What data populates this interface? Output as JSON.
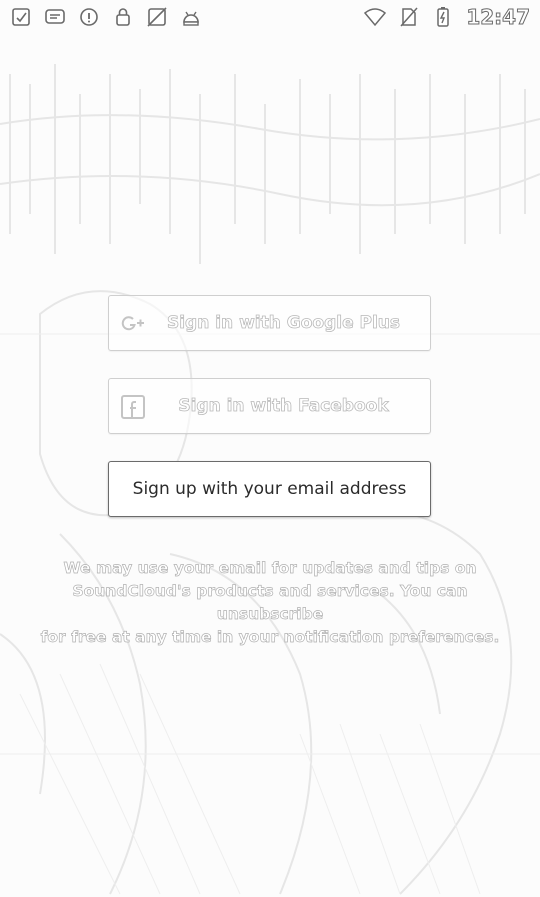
{
  "status_bar": {
    "icons": [
      "tasks-icon",
      "message-icon",
      "info-icon",
      "lock-icon",
      "no-image-icon",
      "android-icon"
    ],
    "right_icons": [
      "wifi-icon",
      "no-sim-icon",
      "battery-charging-icon"
    ],
    "time": "12:47"
  },
  "auth": {
    "google_label": "Sign in with Google Plus",
    "facebook_label": "Sign in with Facebook",
    "email_label": "Sign up with your email address"
  },
  "disclaimer": {
    "line1": "We may use your email for updates and tips on",
    "line2": "SoundCloud's products and services. You can unsubscribe",
    "line3": "for free at any time in your notification preferences."
  }
}
